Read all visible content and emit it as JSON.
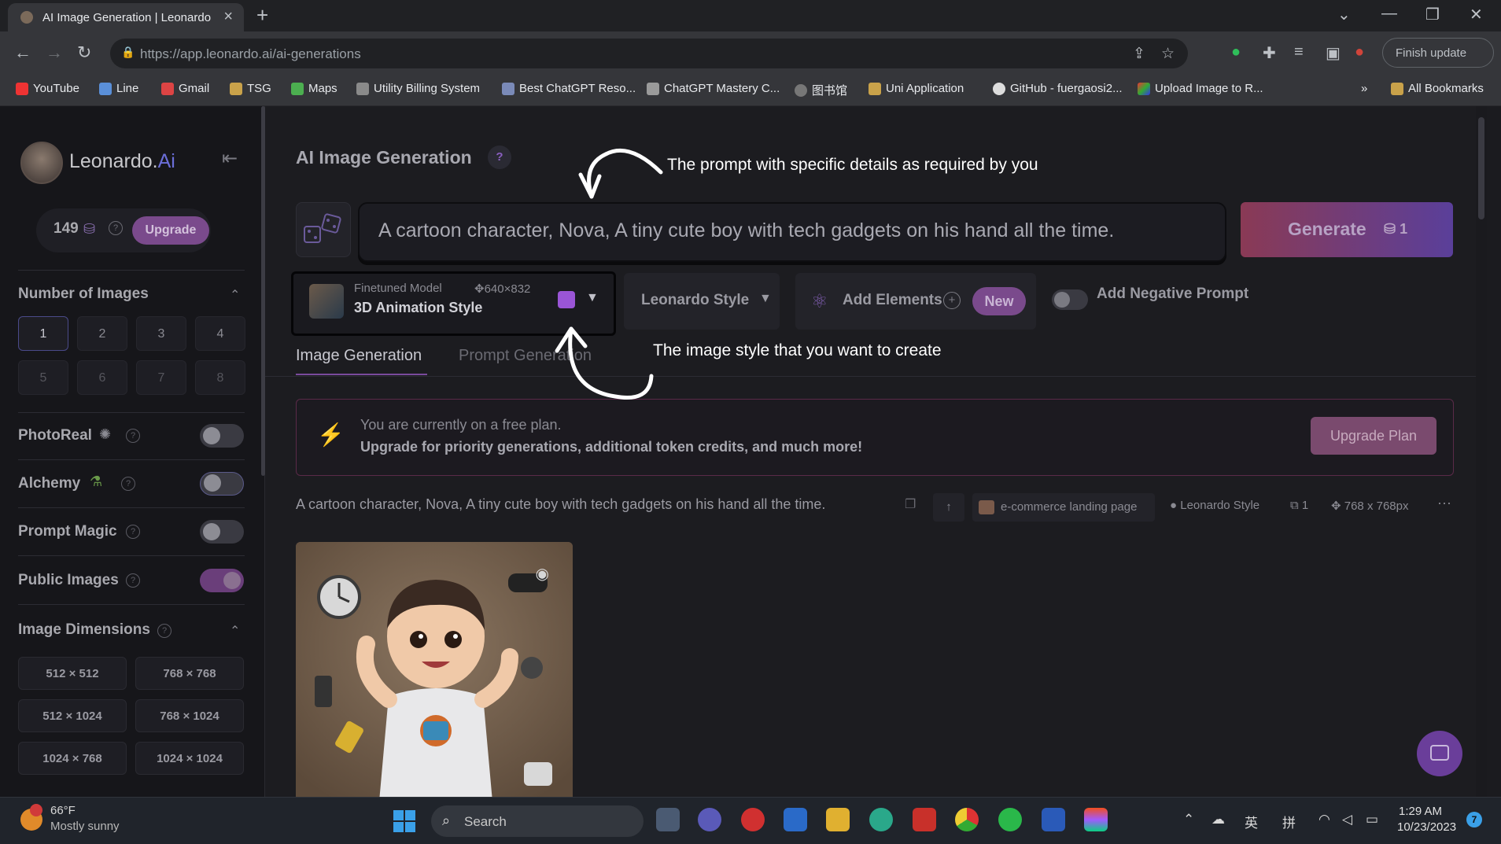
{
  "browser": {
    "tab_title": "AI Image Generation | Leonardo",
    "url": "https://app.leonardo.ai/ai-generations",
    "finish_update": "Finish update",
    "bookmarks": [
      "YouTube",
      "Line",
      "Gmail",
      "TSG",
      "Maps",
      "Utility Billing System",
      "Best ChatGPT Reso...",
      "ChatGPT Mastery C...",
      "图书馆",
      "Uni Application",
      "GitHub - fuergaosi2...",
      "Upload Image to R..."
    ],
    "more_bookmarks": "»",
    "all_bookmarks": "All Bookmarks"
  },
  "sidebar": {
    "brand": "Leonardo.",
    "brand_suffix": "Ai",
    "tokens": "149",
    "upgrade": "Upgrade",
    "number_of_images_title": "Number of Images",
    "image_counts": [
      "1",
      "2",
      "3",
      "4",
      "5",
      "6",
      "7",
      "8"
    ],
    "selected_count": "1",
    "toggles": [
      {
        "label": "PhotoReal",
        "on": false
      },
      {
        "label": "Alchemy",
        "on": false
      },
      {
        "label": "Prompt Magic",
        "on": false
      },
      {
        "label": "Public Images",
        "on": true
      }
    ],
    "dimensions_title": "Image Dimensions",
    "dimensions": [
      "512 × 512",
      "768 × 768",
      "512 × 1024",
      "768 × 1024",
      "1024 × 768",
      "1024 × 1024"
    ]
  },
  "main": {
    "title": "AI Image Generation",
    "title_help": "?",
    "prompt": "A cartoon character, Nova, A tiny cute boy with tech gadgets on his hand all the time.",
    "generate_label": "Generate",
    "generate_cost": "1",
    "model": {
      "sub": "Finetuned Model",
      "size": "640×832",
      "name": "3D Animation Style"
    },
    "style": "Leonardo Style",
    "add_elements": "Add Elements",
    "new_badge": "New",
    "negative_prompt": "Add Negative Prompt",
    "tabs": [
      "Image Generation",
      "Prompt Generation"
    ],
    "banner": {
      "line1": "You are currently on a free plan.",
      "line2": "Upgrade for priority generations, additional token credits, and much more!",
      "button": "Upgrade Plan"
    },
    "generation": {
      "prompt": "A cartoon character, Nova, A tiny cute boy with tech gadgets on his hand all the time.",
      "element": "e-commerce landing page",
      "style": "Leonardo Style",
      "count": "1",
      "size": "768 x 768px",
      "more": "···"
    }
  },
  "annotations": {
    "prompt_note": "The prompt with specific details as required by you",
    "style_note": "The image style that you want to create"
  },
  "taskbar": {
    "temp": "66°F",
    "weather": "Mostly sunny",
    "search": "Search",
    "time": "1:29 AM",
    "date": "10/23/2023",
    "ime1": "英",
    "ime2": "拼",
    "notif_count": "7"
  }
}
